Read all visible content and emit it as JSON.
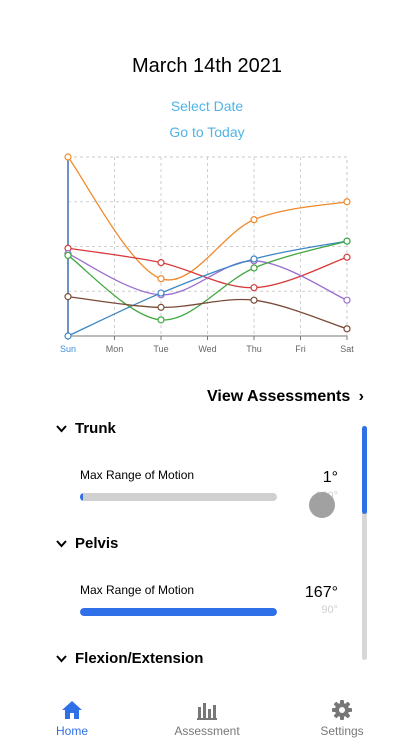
{
  "header": {
    "date_title": "March 14th 2021"
  },
  "links": {
    "select_date": "Select Date",
    "go_to_today": "Go to Today"
  },
  "colors": {
    "accent_link": "#4fb4e6",
    "primary_blue": "#2f6fe8",
    "track_gray": "#d0d0d0"
  },
  "chart_data": {
    "type": "line",
    "x": [
      "Sun",
      "Mon",
      "Tue",
      "Wed",
      "Thu",
      "Fri",
      "Sat"
    ],
    "highlighted_x": "Sun",
    "ylim": [
      0,
      100
    ],
    "grid": true,
    "series": [
      {
        "color": "#f0892b",
        "points": [
          [
            0,
            100
          ],
          [
            2,
            32
          ],
          [
            4,
            65
          ],
          [
            6,
            75
          ]
        ]
      },
      {
        "color": "#d63a3a",
        "points": [
          [
            0,
            49
          ],
          [
            2,
            41
          ],
          [
            4,
            27
          ],
          [
            6,
            44
          ]
        ]
      },
      {
        "color": "#9a6fcf",
        "points": [
          [
            0,
            46
          ],
          [
            2,
            23
          ],
          [
            4,
            42
          ],
          [
            6,
            20
          ]
        ]
      },
      {
        "color": "#3d86c6",
        "points": [
          [
            0,
            0
          ],
          [
            2,
            24
          ],
          [
            4,
            43
          ],
          [
            6,
            53
          ]
        ]
      },
      {
        "color": "#3fa83f",
        "points": [
          [
            0,
            45
          ],
          [
            2,
            9
          ],
          [
            4,
            38
          ],
          [
            6,
            53
          ]
        ]
      },
      {
        "color": "#7a4b38",
        "points": [
          [
            0,
            22
          ],
          [
            2,
            16
          ],
          [
            4,
            20
          ],
          [
            6,
            4
          ]
        ]
      }
    ]
  },
  "assessments_link": {
    "label": "View Assessments",
    "chevron": "›"
  },
  "sections": [
    {
      "title": "Trunk",
      "metric_label": "Max Range of Motion",
      "value": "1°",
      "sub_value": "180°",
      "progress": 0.01
    },
    {
      "title": "Pelvis",
      "metric_label": "Max Range of Motion",
      "value": "167°",
      "sub_value": "90°",
      "progress": 1.0
    },
    {
      "title": "Flexion/Extension"
    }
  ],
  "tabs": [
    {
      "label": "Home",
      "icon": "home-icon",
      "active": true
    },
    {
      "label": "Assessment",
      "icon": "bar-chart-icon",
      "active": false
    },
    {
      "label": "Settings",
      "icon": "gear-icon",
      "active": false
    }
  ]
}
